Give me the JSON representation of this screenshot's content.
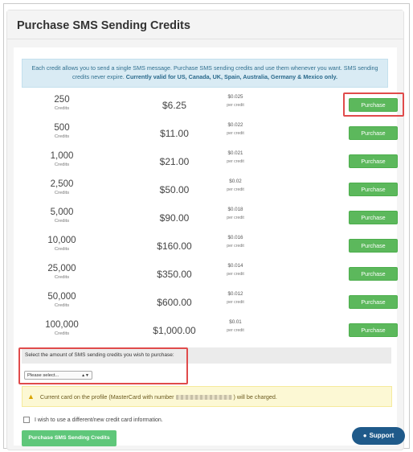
{
  "header": {
    "title": "Purchase SMS Sending Credits"
  },
  "info": {
    "text": "Each credit allows you to send a single SMS message. Purchase SMS sending credits and use them whenever you want. SMS sending credits never expire.",
    "bold": "Currently valid for US, Canada, UK, Spain, Australia, Germany & Mexico only."
  },
  "unit_label": "Credits",
  "per_label": "per credit",
  "button_label": "Purchase",
  "packages": [
    {
      "qty": "250",
      "price": "$6.25",
      "per": "$0.025"
    },
    {
      "qty": "500",
      "price": "$11.00",
      "per": "$0.022"
    },
    {
      "qty": "1,000",
      "price": "$21.00",
      "per": "$0.021"
    },
    {
      "qty": "2,500",
      "price": "$50.00",
      "per": "$0.02"
    },
    {
      "qty": "5,000",
      "price": "$90.00",
      "per": "$0.018"
    },
    {
      "qty": "10,000",
      "price": "$160.00",
      "per": "$0.016"
    },
    {
      "qty": "25,000",
      "price": "$350.00",
      "per": "$0.014"
    },
    {
      "qty": "50,000",
      "price": "$600.00",
      "per": "$0.012"
    },
    {
      "qty": "100,000",
      "price": "$1,000.00",
      "per": "$0.01"
    }
  ],
  "select": {
    "label": "Select the amount of SMS sending credits you wish to purchase:",
    "value": "Please select..."
  },
  "warning": {
    "before": "Current card on the profile (MasterCard with number",
    "after": ") will be charged."
  },
  "checkbox_label": "I wish to use a different/new credit card information.",
  "submit_label": "Purchase SMS Sending Credits",
  "support_label": "Support",
  "colors": {
    "button": "#5cb85c",
    "highlight": "#e04b4b",
    "info_bg": "#d9ebf4",
    "warning_bg": "#fcf8d4",
    "support": "#1f5a8a"
  },
  "icons": {
    "warning": "warning-icon",
    "support": "chat-bubble-icon"
  }
}
